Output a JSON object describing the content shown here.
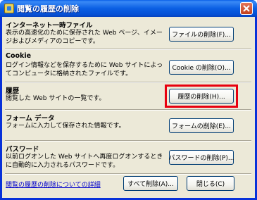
{
  "window": {
    "title": "閲覧の履歴の削除"
  },
  "sections": [
    {
      "title": "インターネット一時ファイル",
      "description": "表示の高速化のために保存された Web ページ、イメージおよびメディアのコピーです。",
      "button": "ファイルの削除(F)..."
    },
    {
      "title": "Cookie",
      "description": "ログイン情報などを保存するために Web サイトによってコンピュータに格納されたファイルです。",
      "button": "Cookie の削除(O)..."
    },
    {
      "title": "履歴",
      "description": "閲覧した Web サイトの一覧です。",
      "button": "履歴の削除(H)..."
    },
    {
      "title": "フォーム データ",
      "description": "フォームに入力して保存された情報です。",
      "button": "フォームの削除(E)..."
    },
    {
      "title": "パスワード",
      "description": "以前ログオンした Web サイトへ再度ログオンするときに自動的に入力されるパスワードです。",
      "button": "パスワードの削除(P)..."
    }
  ],
  "footer": {
    "link": "閲覧の履歴の削除についての詳細",
    "delete_all": "すべて削除(A)...",
    "close": "閉じる(C)"
  },
  "colors": {
    "highlight": "#e8000f",
    "titlebar": "#0a5fe8",
    "dialog": "#ece9d8"
  }
}
